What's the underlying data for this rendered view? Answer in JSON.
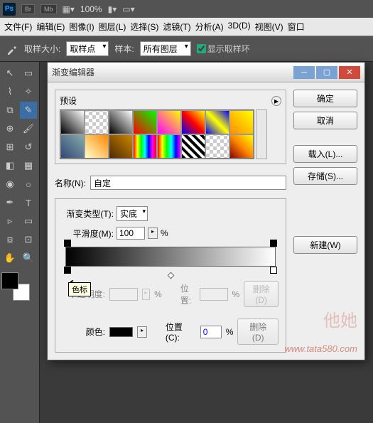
{
  "header": {
    "ps": "Ps",
    "br": "Br",
    "mb": "Mb",
    "zoom": "100%"
  },
  "menubar": [
    "文件(F)",
    "编辑(E)",
    "图像(I)",
    "图层(L)",
    "选择(S)",
    "滤镜(T)",
    "分析(A)",
    "3D(D)",
    "视图(V)",
    "窗口"
  ],
  "optbar": {
    "size_label": "取样大小:",
    "size_value": "取样点",
    "sample_label": "样本:",
    "sample_value": "所有图层",
    "ring_label": "显示取样环"
  },
  "dialog": {
    "title": "渐变编辑器",
    "presets_label": "预设",
    "buttons": {
      "ok": "确定",
      "cancel": "取消",
      "load": "载入(L)...",
      "save": "存储(S)...",
      "new": "新建(W)"
    },
    "name_label": "名称(N):",
    "name_value": "自定",
    "grad_type_label": "渐变类型(T):",
    "grad_type_value": "实底",
    "smooth_label": "平滑度(M):",
    "smooth_value": "100",
    "percent": "%",
    "tooltip": "色标",
    "opacity_label": "不透明度:",
    "position_label": "位置:",
    "delete1": "删除(D)",
    "color_label": "颜色:",
    "position_c_label": "位置(C):",
    "position_c_value": "0",
    "delete2": "删除(D)"
  },
  "watermark": "www.tata580.com"
}
